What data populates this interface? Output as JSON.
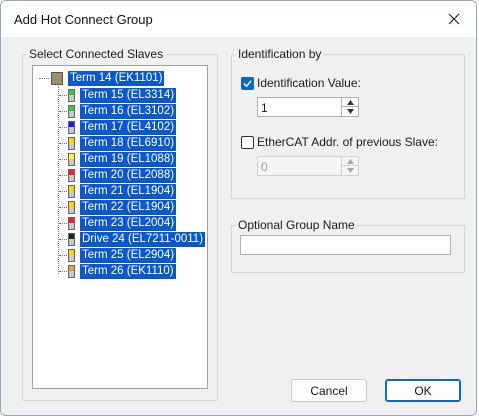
{
  "dialog": {
    "title": "Add Hot Connect Group",
    "close_glyph": "close-icon"
  },
  "slaves_group": {
    "label": "Select Connected Slaves",
    "root": {
      "label": "Term 14 (EK1101)",
      "icon": "coupler-terminal-icon"
    },
    "items": [
      {
        "label": "Term 15 (EL3314)",
        "color": "#33cc33"
      },
      {
        "label": "Term 16 (EL3102)",
        "color": "#33cc33"
      },
      {
        "label": "Term 17 (EL4102)",
        "color": "#1a1aff"
      },
      {
        "label": "Term 18 (EL6910)",
        "color": "#ffd400"
      },
      {
        "label": "Term 19 (EL1088)",
        "color": "#ffff33"
      },
      {
        "label": "Term 20 (EL2088)",
        "color": "#ff2020"
      },
      {
        "label": "Term 21 (EL1904)",
        "color": "#ffd400"
      },
      {
        "label": "Term 22 (EL1904)",
        "color": "#ffd400"
      },
      {
        "label": "Term 23 (EL2004)",
        "color": "#ff2020"
      },
      {
        "label": "Drive 24 (EL7211-0011)",
        "color": "#222222"
      },
      {
        "label": "Term 25 (EL2904)",
        "color": "#ffd400"
      },
      {
        "label": "Term 26 (EK1110)",
        "color": "#e0a040"
      }
    ]
  },
  "identification": {
    "label": "Identification by",
    "value_option": {
      "label": "Identification Value:",
      "checked": true,
      "value": "1"
    },
    "addr_option": {
      "label": "EtherCAT Addr. of previous Slave:",
      "checked": false,
      "value": "0"
    }
  },
  "group_name": {
    "label": "Optional Group Name",
    "value": ""
  },
  "buttons": {
    "cancel": "Cancel",
    "ok": "OK"
  }
}
